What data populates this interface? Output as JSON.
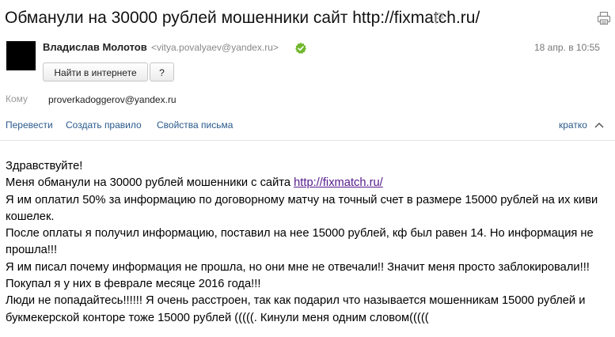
{
  "message": {
    "subject": "Обманули на 30000 рублей мошенники сайт http://fixmatch.ru/",
    "sender": {
      "name": "Владислав Молотов",
      "email": "<vitya.povalyaev@yandex.ru>"
    },
    "date": "18 апр. в 10:55",
    "buttons": {
      "search": "Найти в интернете",
      "help": "?"
    },
    "to": {
      "label": "Кому",
      "value": "proverkadoggerov@yandex.ru"
    },
    "actions": {
      "translate": "Перевести",
      "create_rule": "Создать правило",
      "properties": "Свойства письма",
      "brief": "кратко"
    },
    "body": {
      "greeting": "Здравствуйте!",
      "line1_prefix": "Меня обманули на 30000 рублей мошенники с сайта ",
      "line1_link": "http://fixmatch.ru/",
      "para2": "Я им оплатил 50% за информацию по договорному матчу на точный счет в размере 15000 рублей на их киви кошелек.",
      "para3": "После оплаты я получил информацию, поставил на нее 15000 рублей, кф был равен 14. Но информация не прошла!!!",
      "para4": "Я им писал почему информация не прошла, но они мне не отвечали!! Значит меня просто заблокировали!!!",
      "para5": "Покупал я у них в феврале месяце 2016 года!!!",
      "para6": "Люди не попадайтесь!!!!!! Я очень расстроен, так как подарил что называется мошенникам 15000 рублей и букмекерской конторе тоже 15000 рублей (((((. Кинули меня одним словом((((("
    }
  },
  "icons": {
    "flag": "flag-icon",
    "print": "print-icon",
    "verified": "verified-icon",
    "chevron": "chevron-up-icon"
  },
  "colors": {
    "link_action": "#2a5a8c",
    "link_visited": "#551a8b",
    "verified_green": "#6fb62c"
  }
}
